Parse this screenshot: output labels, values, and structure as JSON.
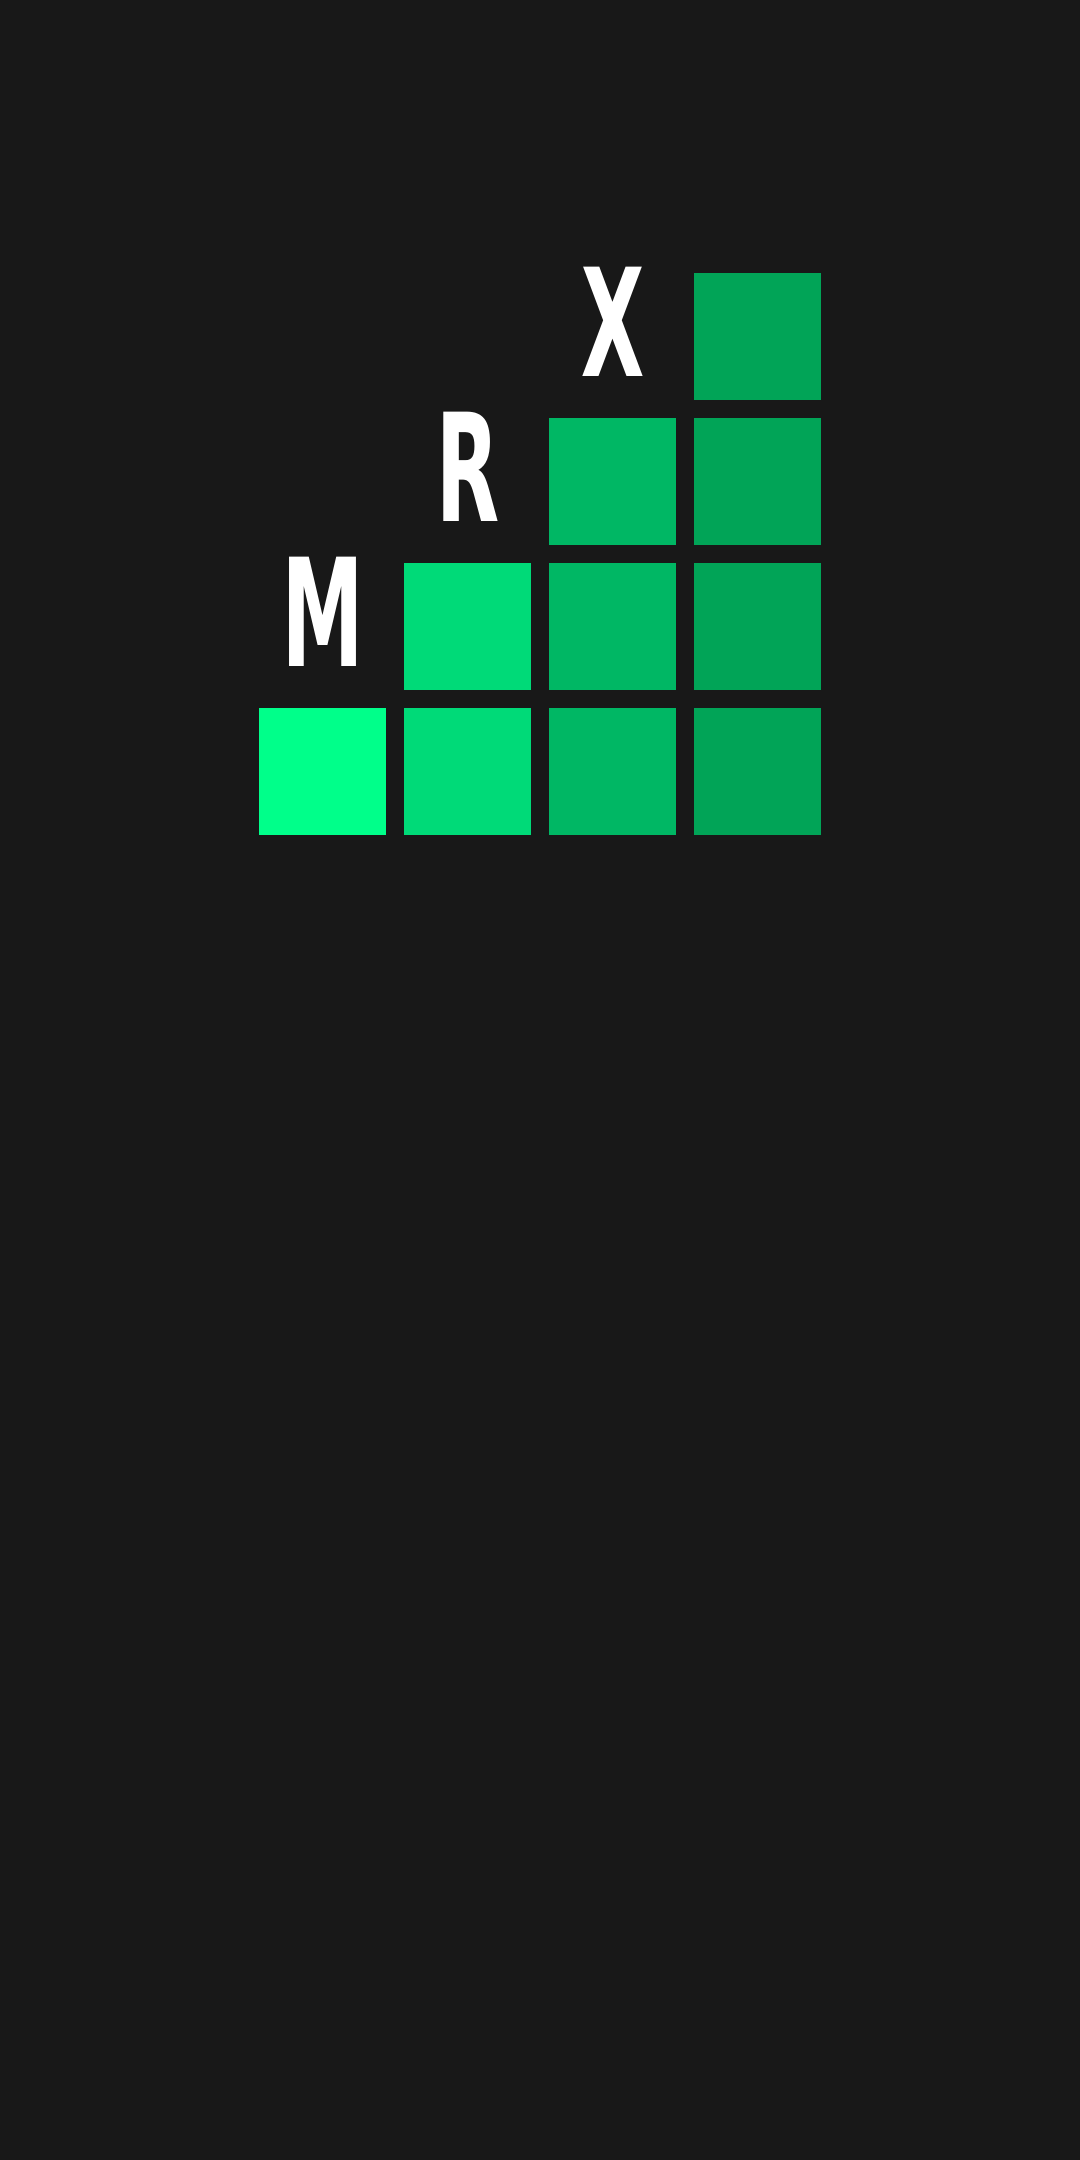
{
  "logo": {
    "letters": [
      "M",
      "R",
      "X"
    ]
  },
  "colors": {
    "background": "#181818",
    "column_1": "#00FF8A",
    "column_2": "#00DA78",
    "column_3": "#00B764",
    "column_4": "#01A457",
    "letter": "#FFFFFF"
  }
}
